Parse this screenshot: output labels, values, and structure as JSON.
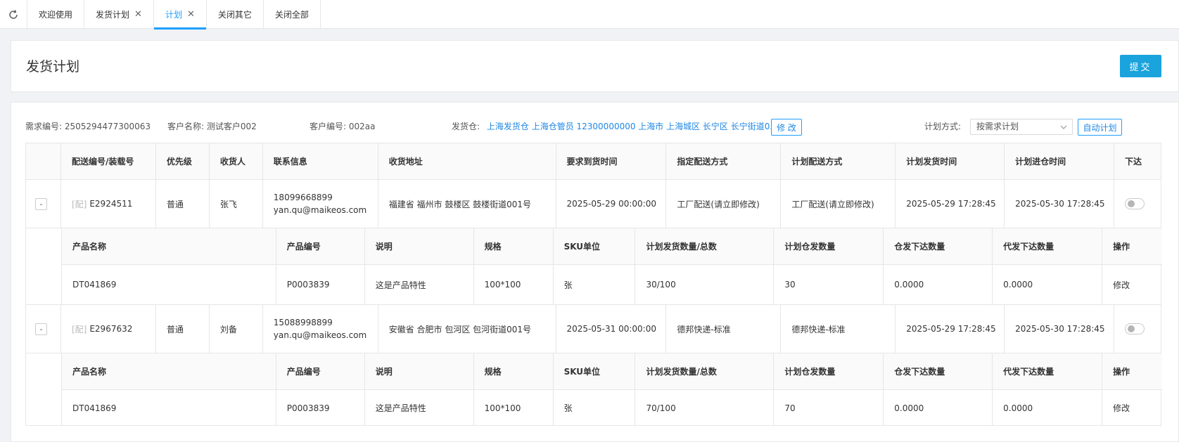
{
  "tabs": [
    {
      "label": "欢迎使用",
      "closable": false,
      "active": false
    },
    {
      "label": "发货计划",
      "closable": true,
      "active": false
    },
    {
      "label": "计划",
      "closable": true,
      "active": true
    },
    {
      "label": "关闭其它",
      "closable": false,
      "active": false
    },
    {
      "label": "关闭全部",
      "closable": false,
      "active": false
    }
  ],
  "header": {
    "title": "发货计划",
    "submit_label": "提交"
  },
  "info": {
    "demand_no_label": "需求编号:",
    "demand_no": "2505294477300063",
    "customer_name_label": "客户名称:",
    "customer_name": "测试客户002",
    "customer_no_label": "客户编号:",
    "customer_no": "002aa",
    "warehouse_label": "发货仓:",
    "warehouse": "上海发货仓 上海仓管员 12300000000 上海市 上海城区 长宁区 长宁街道0...",
    "modify_label": "修 改",
    "plan_mode_label": "计划方式:",
    "plan_mode_value": "按需求计划",
    "auto_plan_label": "自动计划"
  },
  "main_columns": [
    "配送编号/装载号",
    "优先级",
    "收货人",
    "联系信息",
    "收货地址",
    "要求到货时间",
    "指定配送方式",
    "计划配送方式",
    "计划发货时间",
    "计划进仓时间",
    "下达"
  ],
  "sub_columns": [
    "产品名称",
    "产品编号",
    "说明",
    "规格",
    "SKU单位",
    "计划发货数量/总数",
    "计划仓发数量",
    "仓发下达数量",
    "代发下达数量",
    "操作"
  ],
  "orders": [
    {
      "expand_label": "-",
      "tag": "[配]",
      "delivery_no": "E2924511",
      "priority": "普通",
      "receiver": "张飞",
      "phone": "18099668899",
      "email": "yan.qu@maikeos.com",
      "address": "福建省 福州市 鼓楼区 鼓楼街道001号",
      "required_time": "2025-05-29 00:00:00",
      "assigned_method": "工厂配送(请立即修改)",
      "planned_method": "工厂配送(请立即修改)",
      "planned_ship_time": "2025-05-29 17:28:45",
      "planned_in_time": "2025-05-30 17:28:45",
      "issued": false,
      "products": [
        {
          "name": "DT041869",
          "code": "P0003839",
          "desc": "这是产品特性",
          "spec": "100*100",
          "sku_unit": "张",
          "planned_qty": "30/100",
          "warehouse_qty": "30",
          "warehouse_issued": "0.0000",
          "proxy_issued": "0.0000",
          "action": "修改"
        }
      ]
    },
    {
      "expand_label": "-",
      "tag": "[配]",
      "delivery_no": "E2967632",
      "priority": "普通",
      "receiver": "刘备",
      "phone": "15088998899",
      "email": "yan.qu@maikeos.com",
      "address": "安徽省 合肥市 包河区 包河街道001号",
      "required_time": "2025-05-31 00:00:00",
      "assigned_method": "德邦快递-标准",
      "planned_method": "德邦快递-标准",
      "planned_ship_time": "2025-05-29 17:28:45",
      "planned_in_time": "2025-05-30 17:28:45",
      "issued": false,
      "products": [
        {
          "name": "DT041869",
          "code": "P0003839",
          "desc": "这是产品特性",
          "spec": "100*100",
          "sku_unit": "张",
          "planned_qty": "70/100",
          "warehouse_qty": "70",
          "warehouse_issued": "0.0000",
          "proxy_issued": "0.0000",
          "action": "修改"
        }
      ]
    }
  ],
  "colors": {
    "accent": "#1e9fff",
    "primary_button": "#1aa3dc",
    "link": "#1e88e5"
  }
}
